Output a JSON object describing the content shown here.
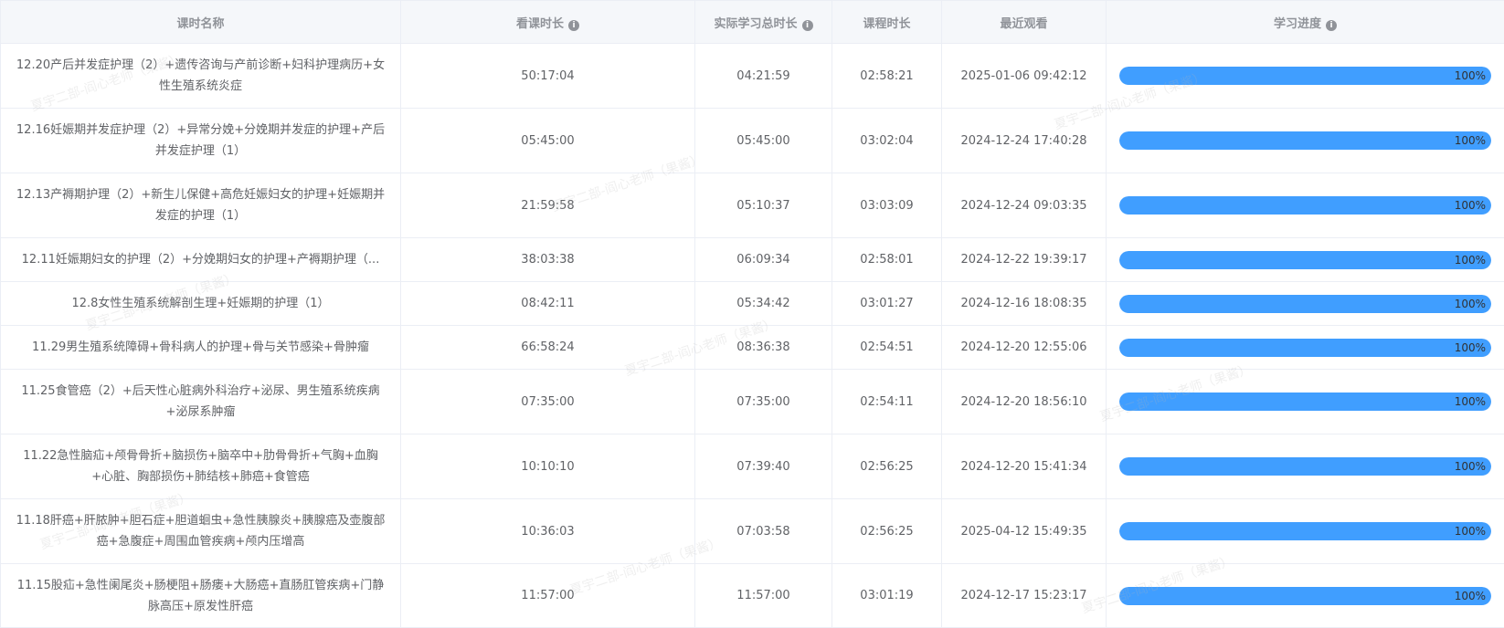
{
  "table": {
    "headers": {
      "name": "课时名称",
      "watch_time": "看课时长",
      "actual_time": "实际学习总时长",
      "course_time": "课程时长",
      "last_watched": "最近观看",
      "progress": "学习进度"
    },
    "rows": [
      {
        "name": "12.20产后并发症护理（2）+遗传咨询与产前诊断+妇科护理病历+女性生殖系统炎症",
        "watch_time": "50:17:04",
        "actual_time": "04:21:59",
        "course_time": "02:58:21",
        "last_watched": "2025-01-06 09:42:12",
        "progress_label": "100%",
        "progress_value": 100
      },
      {
        "name": "12.16妊娠期并发症护理（2）+异常分娩+分娩期并发症的护理+产后并发症护理（1）",
        "watch_time": "05:45:00",
        "actual_time": "05:45:00",
        "course_time": "03:02:04",
        "last_watched": "2024-12-24 17:40:28",
        "progress_label": "100%",
        "progress_value": 100
      },
      {
        "name": "12.13产褥期护理（2）+新生儿保健+高危妊娠妇女的护理+妊娠期并发症的护理（1）",
        "watch_time": "21:59:58",
        "actual_time": "05:10:37",
        "course_time": "03:03:09",
        "last_watched": "2024-12-24 09:03:35",
        "progress_label": "100%",
        "progress_value": 100
      },
      {
        "name": "12.11妊娠期妇女的护理（2）+分娩期妇女的护理+产褥期护理（...",
        "watch_time": "38:03:38",
        "actual_time": "06:09:34",
        "course_time": "02:58:01",
        "last_watched": "2024-12-22 19:39:17",
        "progress_label": "100%",
        "progress_value": 100
      },
      {
        "name": "12.8女性生殖系统解剖生理+妊娠期的护理（1）",
        "watch_time": "08:42:11",
        "actual_time": "05:34:42",
        "course_time": "03:01:27",
        "last_watched": "2024-12-16 18:08:35",
        "progress_label": "100%",
        "progress_value": 100
      },
      {
        "name": "11.29男生殖系统障碍+骨科病人的护理+骨与关节感染+骨肿瘤",
        "watch_time": "66:58:24",
        "actual_time": "08:36:38",
        "course_time": "02:54:51",
        "last_watched": "2024-12-20 12:55:06",
        "progress_label": "100%",
        "progress_value": 100
      },
      {
        "name": "11.25食管癌（2）+后天性心脏病外科治疗+泌尿、男生殖系统疾病+泌尿系肿瘤",
        "watch_time": "07:35:00",
        "actual_time": "07:35:00",
        "course_time": "02:54:11",
        "last_watched": "2024-12-20 18:56:10",
        "progress_label": "100%",
        "progress_value": 100
      },
      {
        "name": "11.22急性脑疝+颅骨骨折+脑损伤+脑卒中+肋骨骨折+气胸+血胸+心脏、胸部损伤+肺结核+肺癌+食管癌",
        "watch_time": "10:10:10",
        "actual_time": "07:39:40",
        "course_time": "02:56:25",
        "last_watched": "2024-12-20 15:41:34",
        "progress_label": "100%",
        "progress_value": 100
      },
      {
        "name": "11.18肝癌+肝脓肿+胆石症+胆道蛔虫+急性胰腺炎+胰腺癌及壶腹部癌+急腹症+周围血管疾病+颅内压增高",
        "watch_time": "10:36:03",
        "actual_time": "07:03:58",
        "course_time": "02:56:25",
        "last_watched": "2025-04-12 15:49:35",
        "progress_label": "100%",
        "progress_value": 100
      },
      {
        "name": "11.15股疝+急性阑尾炎+肠梗阻+肠瘘+大肠癌+直肠肛管疾病+门静脉高压+原发性肝癌",
        "watch_time": "11:57:00",
        "actual_time": "11:57:00",
        "course_time": "03:01:19",
        "last_watched": "2024-12-17 15:23:17",
        "progress_label": "100%",
        "progress_value": 100
      }
    ]
  },
  "watermark": "夏宇二部-阎心老师（果酱）",
  "colors": {
    "progress": "#409eff",
    "header_bg": "#f5f7fa",
    "border": "#ebeef5"
  }
}
